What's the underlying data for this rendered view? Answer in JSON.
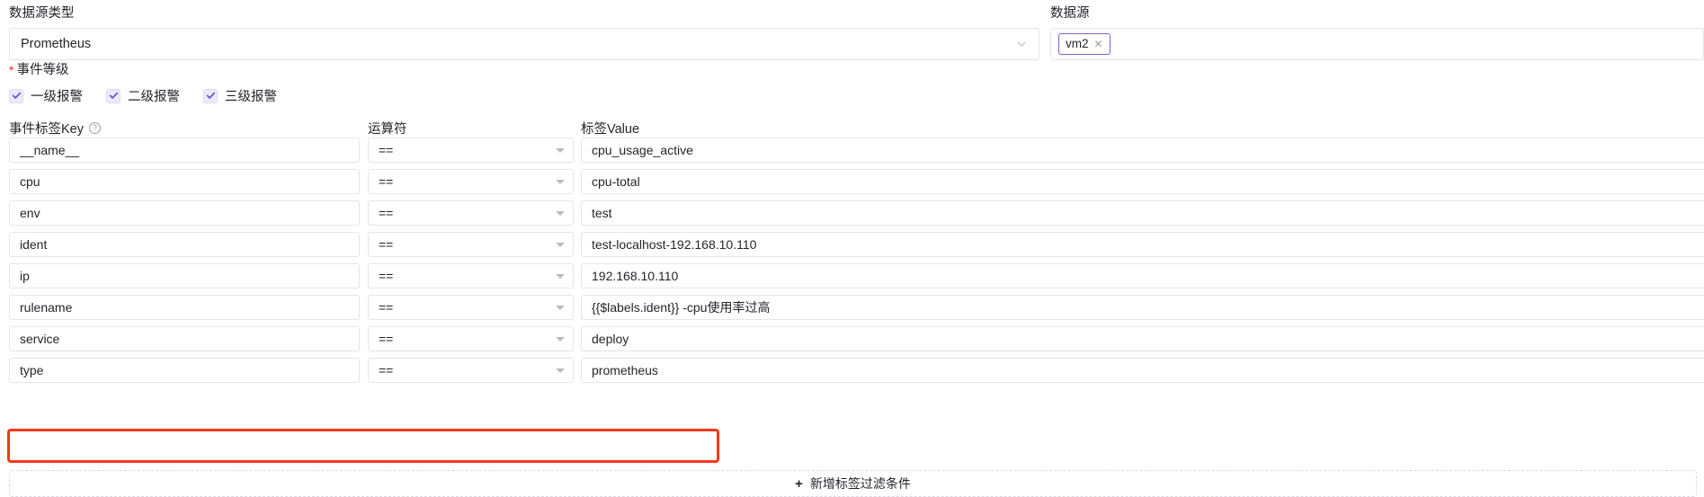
{
  "datasource_type": {
    "label": "数据源类型",
    "value": "Prometheus",
    "caret_icon": "chevron-down-icon"
  },
  "datasource": {
    "label": "数据源",
    "tags": [
      {
        "text": "vm2",
        "close_icon": "close-icon"
      }
    ]
  },
  "event_level": {
    "label": "事件等级",
    "required_mark": "*",
    "options": [
      {
        "label": "一级报警",
        "checked": true
      },
      {
        "label": "二级报警",
        "checked": true
      },
      {
        "label": "三级报警",
        "checked": true
      }
    ]
  },
  "filters": {
    "headers": {
      "key": "事件标签Key",
      "key_help_icon": "?",
      "operator": "运算符",
      "value": "标签Value"
    },
    "rows": [
      {
        "key": "__name__",
        "operator": "==",
        "value": "cpu_usage_active",
        "highlighted": false
      },
      {
        "key": "cpu",
        "operator": "==",
        "value": "cpu-total",
        "highlighted": false
      },
      {
        "key": "env",
        "operator": "==",
        "value": "test",
        "highlighted": false
      },
      {
        "key": "ident",
        "operator": "==",
        "value": "test-localhost-192.168.10.110",
        "highlighted": false
      },
      {
        "key": "ip",
        "operator": "==",
        "value": "192.168.10.110",
        "highlighted": false
      },
      {
        "key": "rulename",
        "operator": "==",
        "value": "{{$labels.ident}} -cpu使用率过高",
        "highlighted": false
      },
      {
        "key": "service",
        "operator": "==",
        "value": "deploy",
        "highlighted": false
      },
      {
        "key": "type",
        "operator": "==",
        "value": "prometheus",
        "highlighted": true
      }
    ],
    "add_button": {
      "plus_icon": "+",
      "label": "新增标签过滤条件"
    }
  },
  "colors": {
    "accent_purple": "#7b5fd0",
    "checkbox_fill": "#ece9fb",
    "required_red": "#f5222d",
    "annotation_red": "#f5391a",
    "border_gray": "#e3e5e8",
    "text_primary": "#1f2329"
  }
}
